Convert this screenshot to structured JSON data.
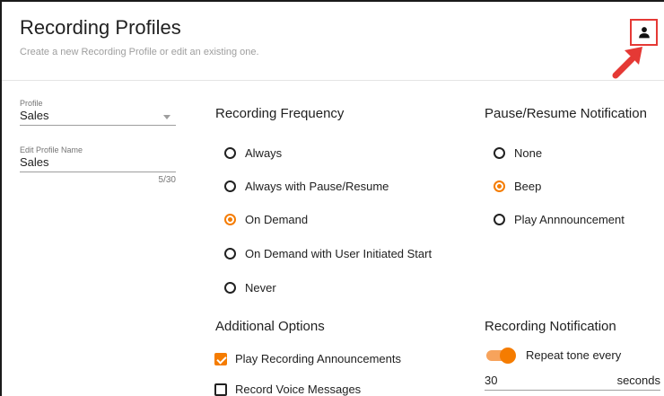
{
  "header": {
    "title": "Recording Profiles",
    "subtitle": "Create a new Recording Profile or edit an existing one.",
    "user_icon": "person-icon"
  },
  "profile": {
    "label": "Profile",
    "value": "Sales"
  },
  "edit_name": {
    "label": "Edit Profile Name",
    "value": "Sales",
    "counter": "5/30"
  },
  "recording_frequency": {
    "title": "Recording Frequency",
    "options": [
      {
        "label": "Always",
        "selected": false
      },
      {
        "label": "Always with Pause/Resume",
        "selected": false
      },
      {
        "label": "On Demand",
        "selected": true
      },
      {
        "label": "On Demand with User Initiated Start",
        "selected": false
      },
      {
        "label": "Never",
        "selected": false
      }
    ]
  },
  "pause_resume": {
    "title": "Pause/Resume Notification",
    "options": [
      {
        "label": "None",
        "selected": false
      },
      {
        "label": "Beep",
        "selected": true
      },
      {
        "label": "Play Annnouncement",
        "selected": false
      }
    ]
  },
  "additional_options": {
    "title": "Additional Options",
    "items": [
      {
        "label": "Play Recording Announcements",
        "checked": true
      },
      {
        "label": "Record Voice Messages",
        "checked": false
      }
    ]
  },
  "recording_notification": {
    "title": "Recording Notification",
    "toggle_label": "Repeat tone every",
    "toggle_on": true,
    "interval_value": "30",
    "interval_unit": "seconds"
  },
  "colors": {
    "accent": "#f57c00",
    "callout": "#e53935"
  }
}
